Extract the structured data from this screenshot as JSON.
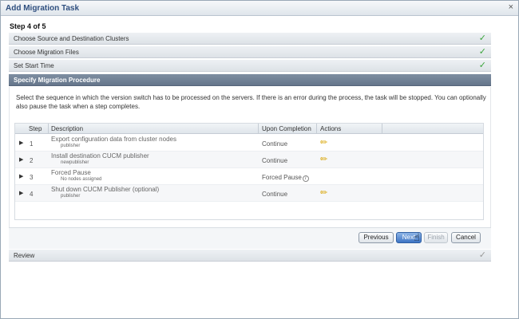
{
  "window": {
    "title": "Add Migration Task",
    "close_glyph": "×"
  },
  "step_indicator": "Step 4 of 5",
  "sections": [
    {
      "label": "Choose Source and Destination Clusters",
      "status": "complete"
    },
    {
      "label": "Choose Migration Files",
      "status": "complete"
    },
    {
      "label": "Set Start Time",
      "status": "complete"
    },
    {
      "label": "Specify Migration Procedure",
      "status": "active"
    }
  ],
  "review_section": {
    "label": "Review",
    "status": "pending"
  },
  "instructions": "Select the sequence in which the version switch has to be processed on the servers. If there is an error during the process, the task will be stopped. You can optionally also pause the task when a step completes.",
  "table": {
    "headers": {
      "step": "Step",
      "description": "Description",
      "upon_completion": "Upon Completion",
      "actions": "Actions"
    },
    "rows": [
      {
        "step": "1",
        "description": "Export configuration data from cluster nodes",
        "sub": "publisher",
        "completion": "Continue",
        "action": "edit"
      },
      {
        "step": "2",
        "description": "Install destination CUCM publisher",
        "sub": "newpublisher",
        "completion": "Continue",
        "action": "edit"
      },
      {
        "step": "3",
        "description": "Forced Pause",
        "sub": "No nodes assigned",
        "completion": "Forced Pause",
        "action": "none"
      },
      {
        "step": "4",
        "description": "Shut down CUCM Publisher (optional)",
        "sub": "publisher",
        "completion": "Continue",
        "action": "edit"
      }
    ]
  },
  "buttons": {
    "previous": "Previous",
    "next": "Next",
    "finish": "Finish",
    "cancel": "Cancel"
  },
  "glyphs": {
    "check": "✓",
    "expand": "▶",
    "pencil": "✏",
    "info": "i",
    "cursor": "☝"
  },
  "colors": {
    "accent": "#3d74c4",
    "check": "#3aa43a",
    "active_header": "#6e7f93",
    "pencil": "#d8a400"
  }
}
